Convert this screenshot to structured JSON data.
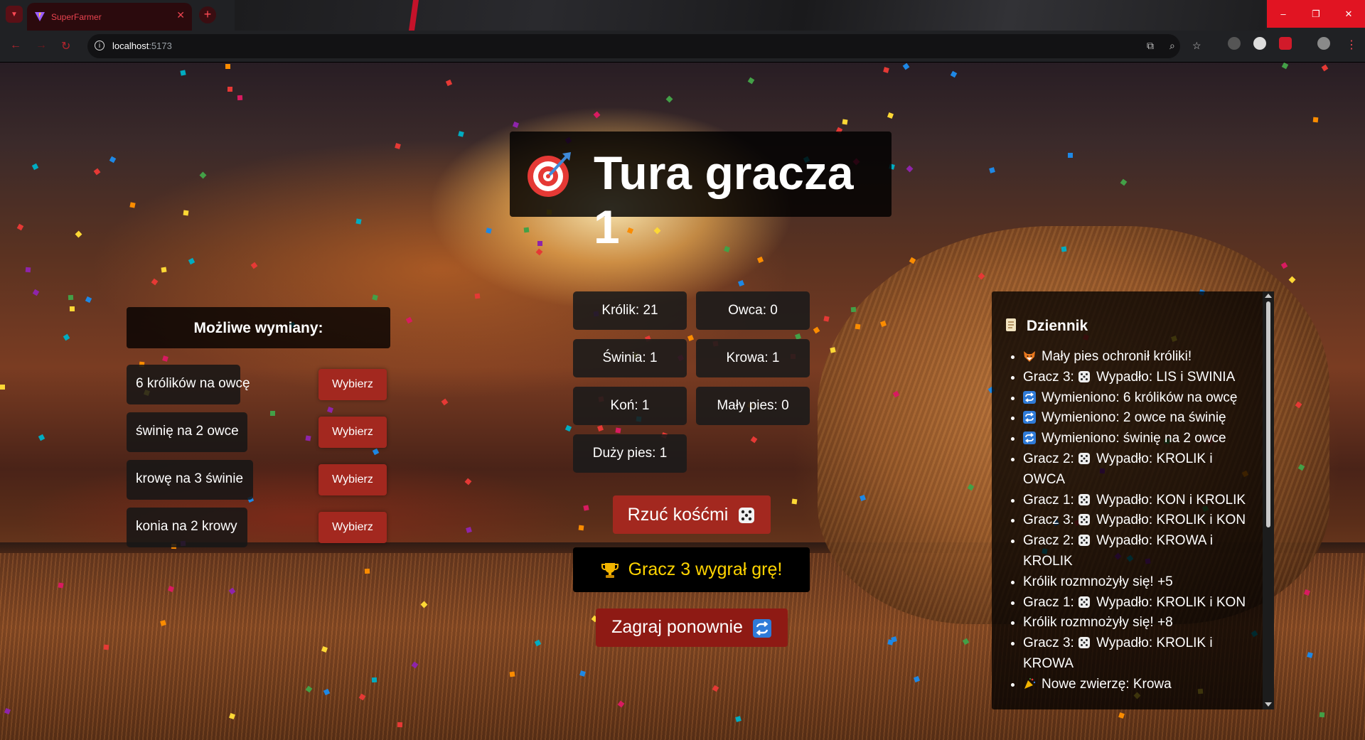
{
  "browser": {
    "tab_title": "SuperFarmer",
    "url_host": "localhost",
    "url_port": ":5173"
  },
  "game": {
    "turn_title": "Tura gracza 1",
    "exchanges": {
      "title": "Możliwe wymiany:",
      "choose_label": "Wybierz",
      "items": [
        {
          "label": "6 królików na owcę"
        },
        {
          "label": "świnię na 2 owce"
        },
        {
          "label": "krowę na 3 świnie"
        },
        {
          "label": "konia na 2 krowy"
        }
      ]
    },
    "animals": [
      {
        "label": "Królik: 21"
      },
      {
        "label": "Owca: 0"
      },
      {
        "label": "Świnia: 1"
      },
      {
        "label": "Krowa: 1"
      },
      {
        "label": "Koń: 1"
      },
      {
        "label": "Mały pies: 0"
      },
      {
        "label": "Duży pies: 1"
      }
    ],
    "roll_label": "Rzuć kośćmi",
    "winner_text": "Gracz 3 wygrał grę!",
    "replay_label": "Zagraj ponownie"
  },
  "log": {
    "title": "Dziennik",
    "entries": [
      {
        "icon": "fox",
        "text": "Mały pies ochronił króliki!"
      },
      {
        "prefix": "Gracz 3:",
        "icon": "dice",
        "text": "Wypadło: LIS i SWINIA"
      },
      {
        "icon": "repeat",
        "text": "Wymieniono: 6 królików na owcę"
      },
      {
        "icon": "repeat",
        "text": "Wymieniono: 2 owce na świnię"
      },
      {
        "icon": "repeat",
        "text": "Wymieniono: świnię na 2 owce"
      },
      {
        "prefix": "Gracz 2:",
        "icon": "dice",
        "text": "Wypadło: KROLIK i OWCA"
      },
      {
        "prefix": "Gracz 1:",
        "icon": "dice",
        "text": "Wypadło: KON i KROLIK"
      },
      {
        "prefix": "Gracz 3:",
        "icon": "dice",
        "text": "Wypadło: KROLIK i KON"
      },
      {
        "prefix": "Gracz 2:",
        "icon": "dice",
        "text": "Wypadło: KROWA i KROLIK"
      },
      {
        "text": "Królik rozmnożyły się! +5"
      },
      {
        "prefix": "Gracz 1:",
        "icon": "dice",
        "text": "Wypadło: KROLIK i KON"
      },
      {
        "text": "Królik rozmnożyły się! +8"
      },
      {
        "prefix": "Gracz 3:",
        "icon": "dice",
        "text": "Wypadło: KROLIK i KROWA"
      },
      {
        "icon": "party",
        "text": "Nowe zwierzę: Krowa"
      }
    ]
  },
  "colors": {
    "button_red": "#a3281f",
    "winner_gold": "#ffd400",
    "window_close_red": "#e11422"
  }
}
